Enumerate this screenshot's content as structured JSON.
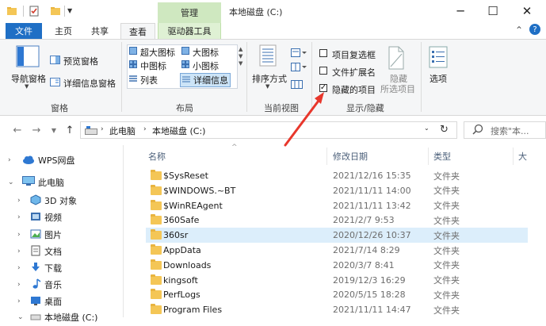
{
  "titlebar": {
    "manage_tab": "管理",
    "window_title": "本地磁盘 (C:)",
    "minimize": "─",
    "maximize": "☐",
    "close": "✕"
  },
  "tabs": {
    "file": "文件",
    "home": "主页",
    "share": "共享",
    "view": "查看",
    "drive_tools": "驱动器工具",
    "collapse": "⌃",
    "help": "?"
  },
  "ribbon": {
    "pane_group": {
      "nav_pane": "导航窗格",
      "preview_pane": "预览窗格",
      "details_pane": "详细信息窗格",
      "label": "窗格"
    },
    "layout_group": {
      "items": [
        "超大图标",
        "大图标",
        "中图标",
        "小图标",
        "列表",
        "详细信息"
      ],
      "label": "布局"
    },
    "current_view_group": {
      "sort_by": "排序方式",
      "label": "当前视图"
    },
    "show_hide_group": {
      "item_checkboxes": "项目复选框",
      "file_extensions": "文件扩展名",
      "hidden_items": "隐藏的项目",
      "hide_selected_line1": "隐藏",
      "hide_selected_line2": "所选项目",
      "label": "显示/隐藏"
    },
    "options": "选项"
  },
  "address": {
    "path": [
      "此电脑",
      "本地磁盘 (C:)"
    ],
    "search_placeholder": "搜索\"本..."
  },
  "nav_pane": {
    "items": [
      "WPS网盘",
      "此电脑",
      "3D 对象",
      "视频",
      "图片",
      "文档",
      "下载",
      "音乐",
      "桌面",
      "本地磁盘 (C:)"
    ]
  },
  "file_list": {
    "columns": [
      "名称",
      "修改日期",
      "类型",
      "大"
    ],
    "rows": [
      {
        "name": "$SysReset",
        "date": "2021/12/16 15:35",
        "type": "文件夹"
      },
      {
        "name": "$WINDOWS.~BT",
        "date": "2021/11/11 14:00",
        "type": "文件夹"
      },
      {
        "name": "$WinREAgent",
        "date": "2021/11/11 13:42",
        "type": "文件夹"
      },
      {
        "name": "360Safe",
        "date": "2021/2/7 9:53",
        "type": "文件夹"
      },
      {
        "name": "360sr",
        "date": "2020/12/26 10:37",
        "type": "文件夹"
      },
      {
        "name": "AppData",
        "date": "2021/7/14 8:29",
        "type": "文件夹"
      },
      {
        "name": "Downloads",
        "date": "2020/3/7 8:41",
        "type": "文件夹"
      },
      {
        "name": "kingsoft",
        "date": "2019/12/3 16:29",
        "type": "文件夹"
      },
      {
        "name": "PerfLogs",
        "date": "2020/5/15 18:28",
        "type": "文件夹"
      },
      {
        "name": "Program Files",
        "date": "2021/11/11 14:47",
        "type": "文件夹"
      }
    ]
  },
  "colors": {
    "file_tab": "#1f6fc5",
    "manage_tab": "#cfe8c0",
    "selected_row": "#dceefb",
    "folder": "#f4c656",
    "annotation_arrow": "#e8372c"
  }
}
